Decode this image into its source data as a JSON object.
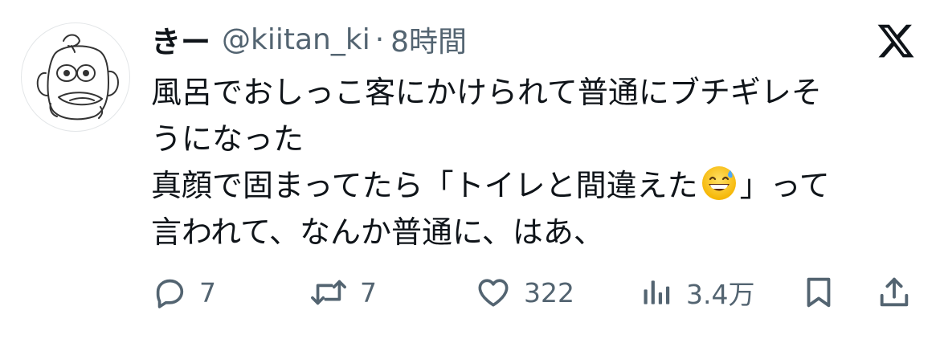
{
  "tweet": {
    "author": {
      "display_name": "きー",
      "handle": "@kiitan_ki",
      "separator": "·",
      "timestamp": "8時間"
    },
    "body_lines": [
      "風呂でおしっこ客にかけられて普通にブチギレそ",
      "うになった"
    ],
    "line3_before": "真顔で固まってたら「トイレと間違えた",
    "line3_after": "」って",
    "line4": "言われて、なんか普通に、はあ、",
    "inline_emoji": "grinning-face-with-sweat-emoji",
    "icons": {
      "logo": "x-logo-icon",
      "reply": "reply-icon",
      "retweet": "retweet-icon",
      "like": "heart-icon",
      "views": "views-icon",
      "bookmark": "bookmark-icon",
      "share": "share-icon"
    },
    "stats": {
      "replies": "7",
      "retweets": "7",
      "likes": "322",
      "views": "3.4万"
    },
    "colors": {
      "text": "#0f1419",
      "muted": "#536471"
    }
  }
}
